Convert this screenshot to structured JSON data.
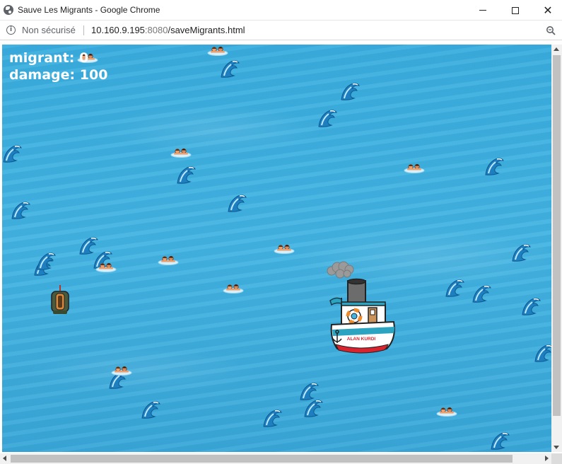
{
  "window": {
    "title": "Sauve Les Migrants - Google Chrome"
  },
  "address_bar": {
    "security_label": "Non sécurisé",
    "url_host": "10.160.9.195",
    "url_port": ":8080",
    "url_path": "/saveMigrants.html"
  },
  "hud": {
    "migrant_label": "migrant: ",
    "migrant_value": "0",
    "damage_label": "damage: ",
    "damage_value": "100"
  },
  "boat": {
    "name": "ALAN KURDI"
  },
  "icons": {
    "page": "globe-icon",
    "info": "info-icon",
    "zoom": "zoom-icon",
    "wave": "wave-icon",
    "swimmer": "swimmer-icon",
    "raft": "raft-icon"
  },
  "colors": {
    "sea": "#43b4e2",
    "hud_text": "#ffffff",
    "boat_hull_red": "#d9232e",
    "boat_stripe_teal": "#2aa4c0"
  }
}
